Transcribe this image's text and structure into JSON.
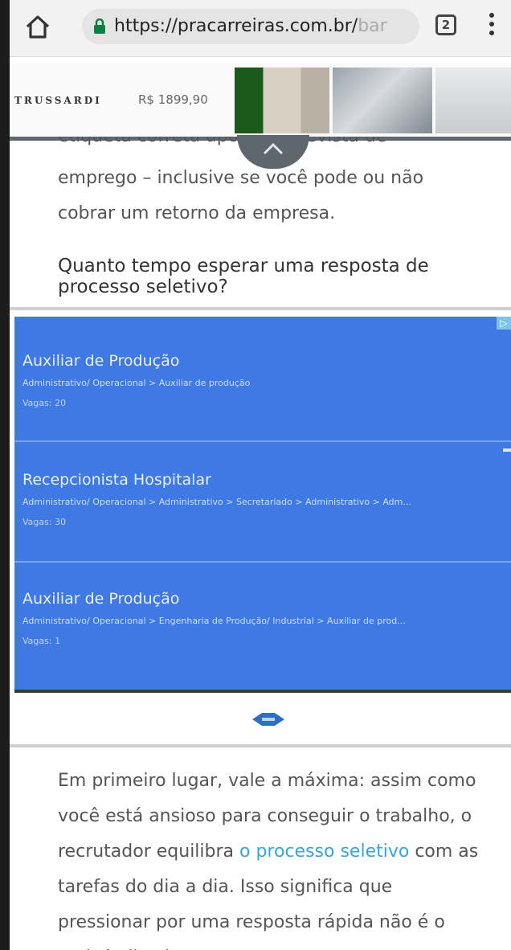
{
  "browser": {
    "url_host": "https://pracarreiras.com.br/",
    "url_rest": "bar",
    "tab_count": "2"
  },
  "top_ad": {
    "brand": "TRUSSARDI",
    "price": "R$ 1899,90"
  },
  "article": {
    "partial_line": "etiqueta correta após a entrevista de",
    "p1_line2": "emprego – inclusive se você pode ou não",
    "p1_line3": "cobrar um retorno da empresa.",
    "heading": "Quanto tempo esperar uma resposta de processo seletivo?",
    "p2_before_link": "Em primeiro lugar, vale a máxima: assim como você está ansioso para conseguir o trabalho, o recrutador equilibra ",
    "p2_link": "o processo seletivo",
    "p2_after_link": " com as tarefas do dia a dia. Isso significa que pressionar por uma resposta rápida não é o mais indicado."
  },
  "job_ad": {
    "jobs": [
      {
        "title": "Auxiliar de Produção",
        "category": "Administrativo/ Operacional > Auxiliar de produção",
        "vagas": "Vagas: 20"
      },
      {
        "title": "Recepcionista Hospitalar",
        "category": "Administrativo/ Operacional > Administrativo > Secretariado > Administrativo > Adm...",
        "vagas": "Vagas: 30"
      },
      {
        "title": "Auxiliar de Produção",
        "category": "Administrativo/ Operacional > Engenharia de Produção/ Industrial > Auxiliar de prod...",
        "vagas": "Vagas: 1"
      }
    ]
  }
}
